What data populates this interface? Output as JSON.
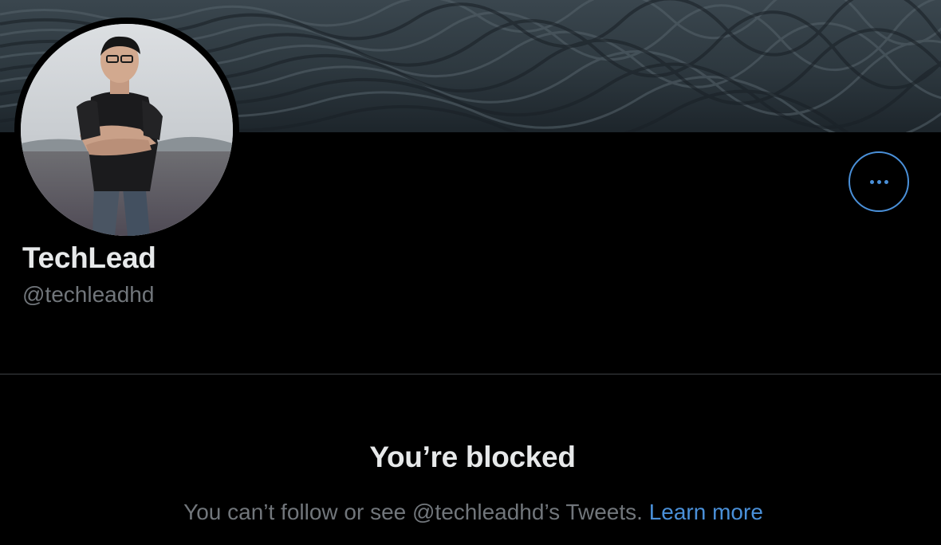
{
  "profile": {
    "display_name": "TechLead",
    "handle": "@techleadhd"
  },
  "banner": {
    "image": "dark ocean waves"
  },
  "avatar": {
    "image": "man in black t-shirt with arms crossed"
  },
  "more_button": {
    "icon": "more-horizontal-icon"
  },
  "blocked": {
    "title": "You’re blocked",
    "message": "You can’t follow or see @techleadhd’s Tweets.",
    "learn_more": "Learn more"
  },
  "colors": {
    "background": "#000000",
    "text_primary": "#e7e9ea",
    "text_secondary": "#71767b",
    "accent": "#4a90d9",
    "divider": "#3e4144"
  }
}
